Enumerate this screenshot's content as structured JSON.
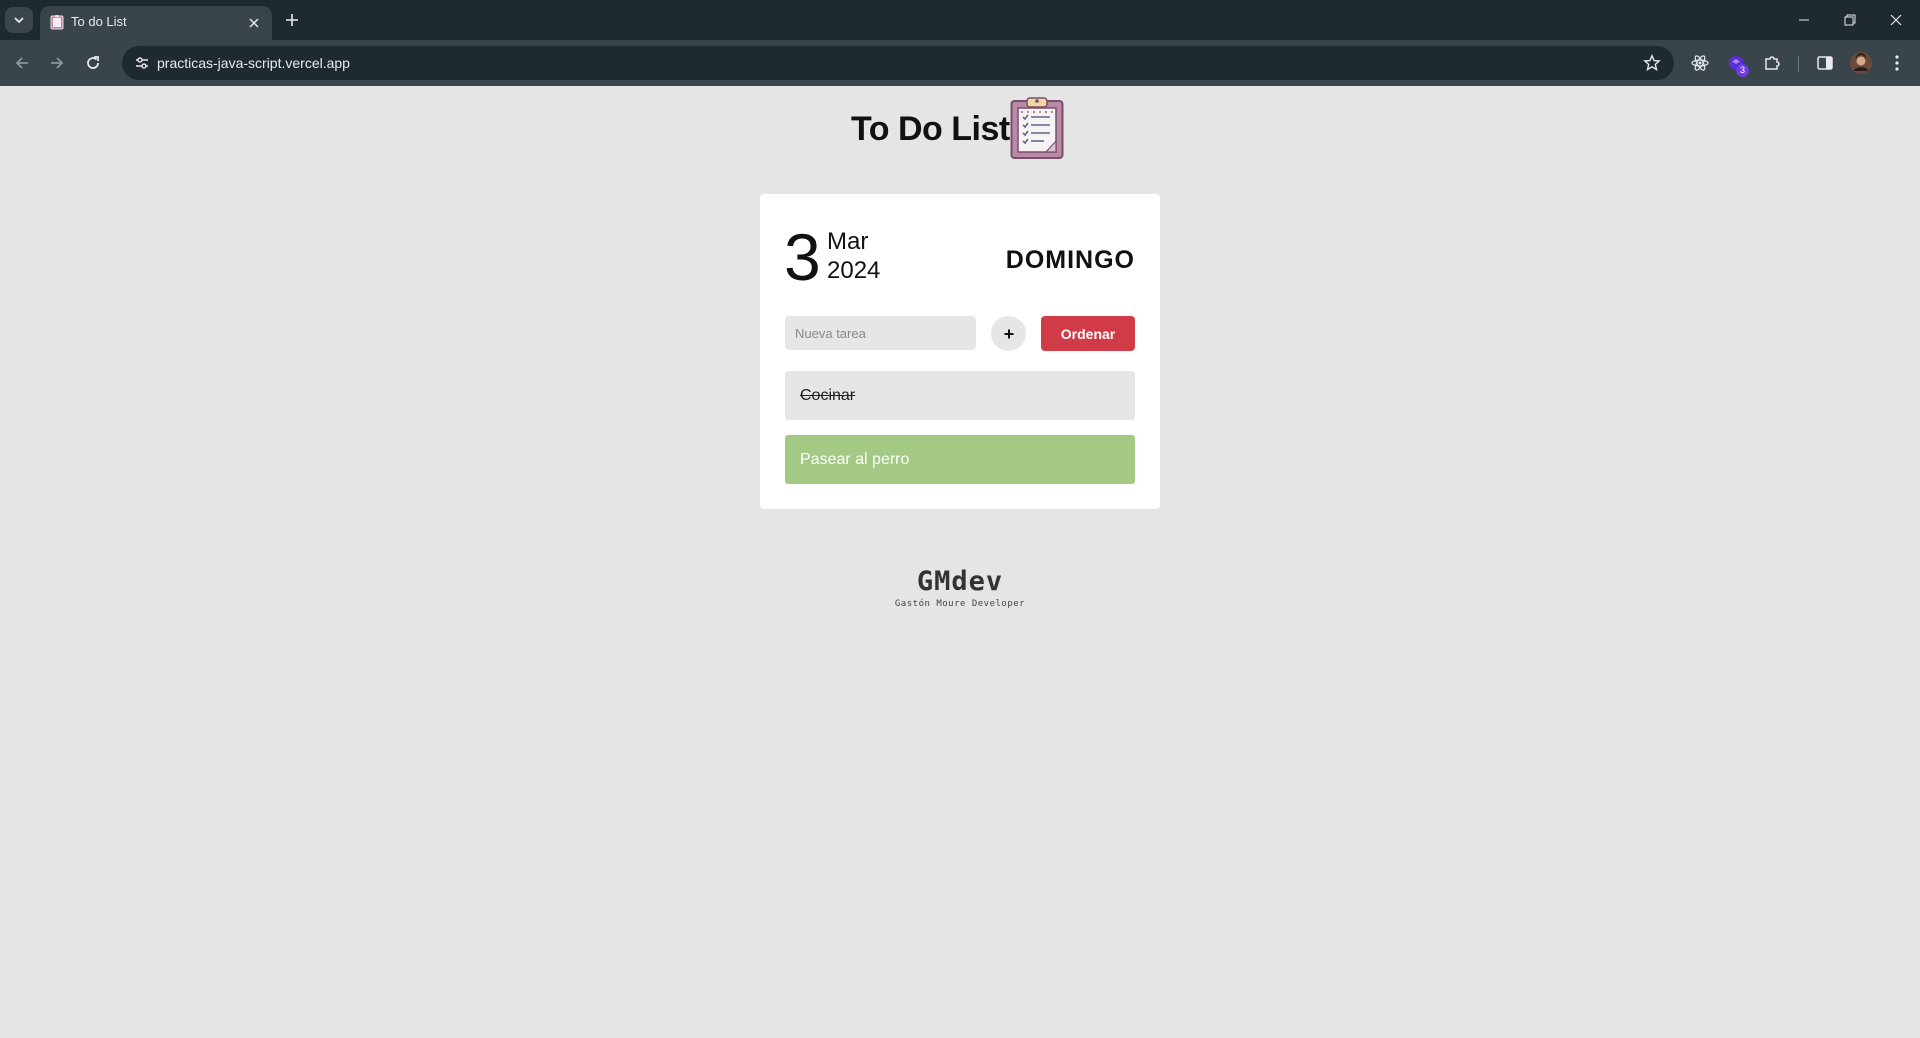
{
  "browser": {
    "tab_title": "To do List",
    "url": "practicas-java-script.vercel.app",
    "extension_badge": "3",
    "icons": {
      "tab_search": "chevron-down-icon",
      "favicon": "clipboard-icon",
      "tab_close": "close-icon",
      "new_tab": "plus-icon",
      "back": "arrow-left-icon",
      "forward": "arrow-right-icon",
      "reload": "reload-icon",
      "site_info": "tune-icon",
      "bookmark": "star-icon",
      "react_devtools": "atom-icon",
      "extension": "hexagon-icon",
      "extensions": "puzzle-icon",
      "side_panel": "side-panel-icon",
      "profile": "avatar",
      "menu": "kebab-icon",
      "minimize": "minimize-icon",
      "restore": "restore-icon",
      "close_window": "close-icon"
    }
  },
  "header": {
    "title": "To Do List",
    "icon": "clipboard-icon"
  },
  "date": {
    "day": "3",
    "month": "Mar",
    "year": "2024",
    "weekday": "DOMINGO"
  },
  "form": {
    "input_placeholder": "Nueva tarea",
    "input_value": "",
    "add_label": "+",
    "order_label": "Ordenar"
  },
  "tasks": [
    {
      "text": "Cocinar",
      "done": true
    },
    {
      "text": "Pasear al perro",
      "done": false
    }
  ],
  "footer": {
    "brand": "GMdev",
    "subtitle": "Gastón Moure Developer"
  },
  "colors": {
    "page_bg": "#e5e5e5",
    "card_bg": "#ffffff",
    "order_button": "#d13b47",
    "task_pending": "#a4c984",
    "task_done": "#e6e6e6",
    "chrome_dark": "#1f2a30",
    "chrome_toolbar": "#3a454b"
  }
}
